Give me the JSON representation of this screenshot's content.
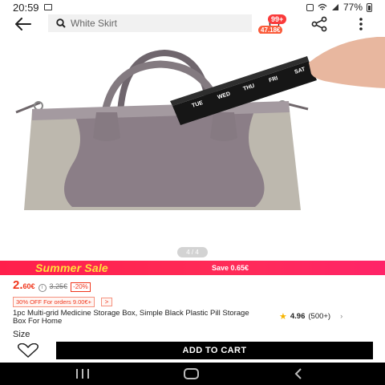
{
  "status_bar": {
    "time": "20:59",
    "battery": "77%"
  },
  "search": {
    "query": "White Skirt"
  },
  "cart": {
    "count": "99+",
    "price": "47.18€"
  },
  "gallery": {
    "indicator": "4 / 4"
  },
  "banner": {
    "title": "Summer Sale",
    "save": "Save 0.65€"
  },
  "price": {
    "main": "2.",
    "cents": "60€",
    "original": "3.25€",
    "discount": "-20%"
  },
  "coupon": {
    "text": "30% OFF For orders 9.00€+",
    "arrow": ">"
  },
  "product": {
    "title": "1pc Multi-grid Medicine Storage Box, Simple Black Plastic Pill Storage Box For Home",
    "rating": "4.96",
    "review_count": "(500+)"
  },
  "size": {
    "label": "Size"
  },
  "actions": {
    "add_to_cart": "ADD TO CART"
  },
  "pill_box": {
    "labels": [
      "TUE",
      "WED",
      "THU",
      "FRI",
      "SAT"
    ]
  },
  "colors": {
    "accent": "#f0361c",
    "sale_bg": "#ff1f4b",
    "sale_text": "#ffe13b",
    "bag": "#8b7e87",
    "bag_light": "#bdb8ae"
  },
  "icons": [
    "back-arrow-icon",
    "search-icon",
    "cart-icon",
    "share-icon",
    "more-vertical-icon",
    "info-icon",
    "star-icon",
    "heart-icon",
    "chevron-right-icon"
  ]
}
